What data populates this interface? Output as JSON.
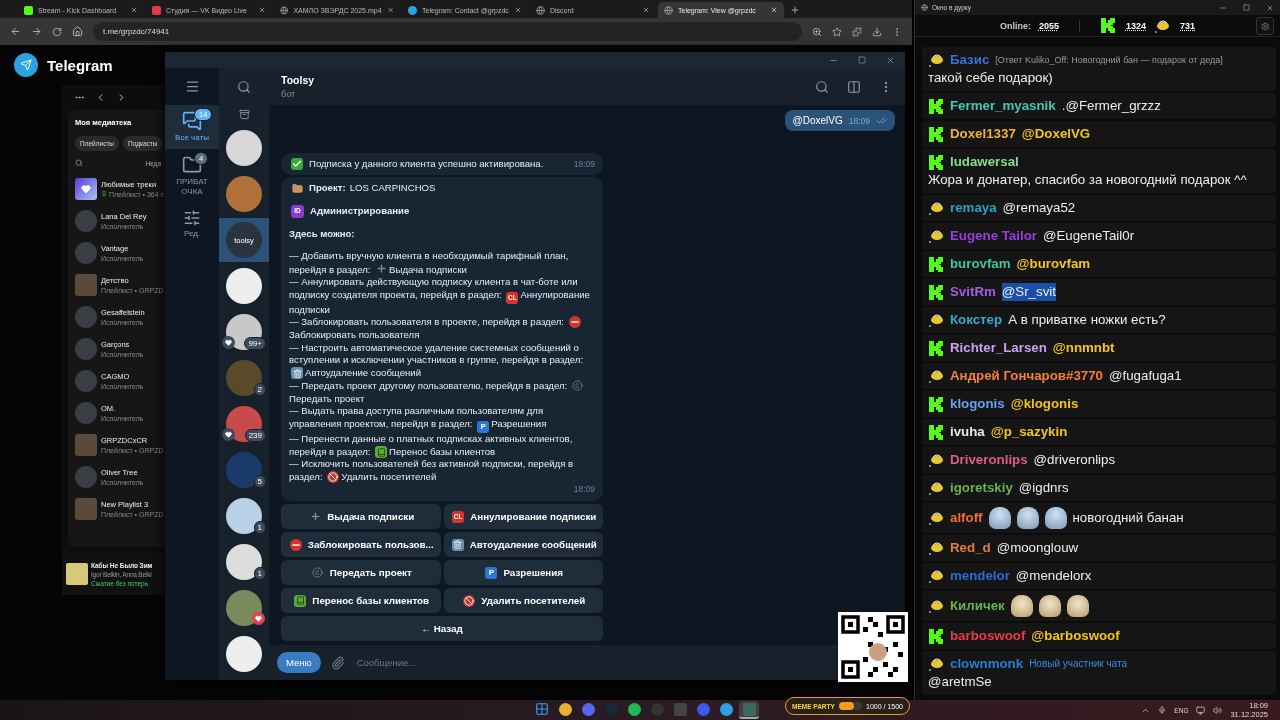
{
  "browser": {
    "tabs": [
      {
        "title": "Stream - Kick Dashboard",
        "selected": false
      },
      {
        "title": "Студия — VK Видео Live",
        "selected": false
      },
      {
        "title": "ХАМЛО ЗВЭРДС 2025.mp4",
        "selected": false
      },
      {
        "title": "Telegram: Contact @grpzdc",
        "selected": false
      },
      {
        "title": "Discord",
        "selected": false
      },
      {
        "title": "Telegram: View @grpzdc",
        "selected": true
      }
    ],
    "address": "t.me/grpzdc/74941"
  },
  "web_header": {
    "title": "Telegram"
  },
  "music": {
    "library_title": "Моя медиатека",
    "chips": [
      "Плейлисты",
      "Подкасты"
    ],
    "sort_label": "Неда",
    "items": [
      {
        "kind": "liked",
        "title": "Любимые треки",
        "subtitle": "Плейлист • 364 т",
        "pinned": true
      },
      {
        "kind": "artist",
        "title": "Lana Del Rey",
        "subtitle": "Исполнитель",
        "pinned": false
      },
      {
        "kind": "artist",
        "title": "Vantage",
        "subtitle": "Исполнитель",
        "pinned": false
      },
      {
        "kind": "playlist",
        "title": "Детство",
        "subtitle": "Плейлист • GRPZD",
        "pinned": false
      },
      {
        "kind": "artist",
        "title": "Gesaffelstein",
        "subtitle": "Исполнитель",
        "pinned": false
      },
      {
        "kind": "artist",
        "title": "Garçons",
        "subtitle": "Исполнитель",
        "pinned": false
      },
      {
        "kind": "artist",
        "title": "CAGMO",
        "subtitle": "Исполнитель",
        "pinned": false
      },
      {
        "kind": "artist",
        "title": "OM.",
        "subtitle": "Исполнитель",
        "pinned": false
      },
      {
        "kind": "playlist",
        "title": "GRPZDCxCR",
        "subtitle": "Плейлист • GRPZD",
        "pinned": false
      },
      {
        "kind": "artist",
        "title": "Oliver Tree",
        "subtitle": "Исполнитель",
        "pinned": false
      },
      {
        "kind": "playlist",
        "title": "New Playlist 3",
        "subtitle": "Плейлист • GRPZD",
        "pinned": false
      }
    ],
    "player": {
      "title": "Кабы Не Было Зим",
      "artist": "Igor Belkin, Anna Belki",
      "quality": "Сжатие без потерь"
    }
  },
  "telegram": {
    "folders": [
      {
        "kind": "chats",
        "label": "Все чаты",
        "badge": "14",
        "selected": true
      },
      {
        "kind": "folder",
        "label": "ПРИВАТ ОЧКА",
        "badge": "4",
        "selected": false
      },
      {
        "kind": "edit",
        "label": "Ред.",
        "selected": false
      }
    ],
    "chats": [
      {
        "selected": false,
        "heart": false
      },
      {
        "selected": false,
        "heart": false
      },
      {
        "selected": true,
        "heart": false,
        "avatar_text": "toolsy"
      },
      {
        "selected": false,
        "heart": false
      },
      {
        "selected": false,
        "heart": true,
        "badge": "99+"
      },
      {
        "selected": false,
        "heart": false,
        "badge": "2"
      },
      {
        "selected": false,
        "heart": true,
        "badge": "239"
      },
      {
        "selected": false,
        "heart": false,
        "badge": "5"
      },
      {
        "selected": false,
        "heart": false,
        "badge": "1"
      },
      {
        "selected": false,
        "heart": false,
        "badge": "1"
      },
      {
        "selected": false,
        "heart": true,
        "heart_red": true
      },
      {
        "selected": false,
        "heart": false
      }
    ],
    "chat": {
      "title": "Toolsy",
      "subtitle": "бот"
    },
    "outgoing": {
      "text": "@DoxelVG",
      "time": "18:09",
      "read": true
    },
    "notice": {
      "icon": {
        "kind": "check"
      },
      "text": "Подписка у данного клиента успешно активирована.",
      "time": "18:09"
    },
    "bot_message": {
      "project_label": "Проект:",
      "project_name": "LOS CARPINCHOS",
      "section_icon": {
        "kind": "id",
        "label": "ID"
      },
      "section_title": "Администрирование",
      "intro": "Здесь можно:",
      "time": "18:09",
      "items": [
        {
          "text": "— Добавить вручную клиента в необходимый тарифный план, перейдя в раздел:",
          "icon": {
            "kind": "plus"
          },
          "target": "Выдача подписки"
        },
        {
          "text": "— Аннулировать действующую подписку клиента в чат-боте или подписку создателя проекта, перейдя в раздел:",
          "icon": {
            "kind": "cl",
            "label": "CL"
          },
          "target": "Аннулирование подписки"
        },
        {
          "text": "— Заблокировать пользователя в проекте, перейдя в раздел:",
          "icon": {
            "kind": "no_entry"
          },
          "target": "Заблокировать пользователя"
        },
        {
          "text": "— Настроить автоматическое удаление системных сообщений о вступлении и исключении участников в группе, перейдя в раздел:",
          "icon": {
            "kind": "bin"
          },
          "target": "Автоудаление сообщений"
        },
        {
          "text": "— Передать проект другому пользователю, перейдя в раздел:",
          "icon": {
            "kind": "copyright"
          },
          "target": "Передать проект"
        },
        {
          "text": "— Выдать права доступа различным пользователям для управления проектом, перейдя в раздел:",
          "icon": {
            "kind": "p",
            "label": "P"
          },
          "target": "Разрешения"
        },
        {
          "text": "— Перенести данные о платных подписках активных клиентов, перейдя в раздел:",
          "icon": {
            "kind": "book"
          },
          "target": "Перенос базы клиентов"
        },
        {
          "text": "— Исключить пользователей без активной подписки, перейдя в раздел:",
          "icon": {
            "kind": "prohibited"
          },
          "target": "Удалить посетителей"
        }
      ]
    },
    "buttons": [
      {
        "icon": {
          "kind": "plus"
        },
        "label": "Выдача подписки",
        "wide": false
      },
      {
        "icon": {
          "kind": "cl",
          "label": "CL"
        },
        "label": "Аннулирование подписки",
        "wide": false
      },
      {
        "icon": {
          "kind": "no_entry"
        },
        "label": "Заблокировать пользов...",
        "wide": false
      },
      {
        "icon": {
          "kind": "bin"
        },
        "label": "Автоудаление сообщений",
        "wide": false
      },
      {
        "icon": {
          "kind": "copyright"
        },
        "label": "Передать проект",
        "wide": false
      },
      {
        "icon": {
          "kind": "p",
          "label": "P"
        },
        "label": "Разрешения",
        "wide": false
      },
      {
        "icon": {
          "kind": "book"
        },
        "label": "Перенос базы клиентов",
        "wide": false
      },
      {
        "icon": {
          "kind": "prohibited"
        },
        "label": "Удалить посетителей",
        "wide": false
      },
      {
        "label": "← Назад",
        "wide": true
      }
    ],
    "composer": {
      "menu_label": "Меню",
      "placeholder": "Сообщение..."
    }
  },
  "chat_window": {
    "title": "Окно в дурку",
    "online_label": "Online:",
    "online": "2055",
    "kick_count": "1324",
    "bowl_count": "731",
    "messages": [
      {
        "kind": "bowl",
        "name": "Базис",
        "color": "#3f6fd6",
        "reply": "[Ответ Kuliko_Off: Новогодний бан — подарок от деда]",
        "text": "такой себе подарок)",
        "mention": false,
        "selected": false
      },
      {
        "kind": "kick",
        "name": "Fermer_myasnik",
        "color": "#45c8b4",
        "text": ".@Fermer_grzzz",
        "mention": false,
        "selected": false
      },
      {
        "kind": "kick",
        "name": "Doxel1337",
        "color": "#f0b040",
        "text": "@DoxelVG",
        "mention": true,
        "selected": false
      },
      {
        "kind": "kick",
        "name": "ludawersal",
        "color": "#86e08e",
        "text": "Жора и донатер, спасибо за новогодний подарок ^^",
        "mention": false,
        "selected": false
      },
      {
        "kind": "bowl",
        "name": "remaya",
        "color": "#2f9ec4",
        "text": "@remaya52",
        "mention": false,
        "selected": false
      },
      {
        "kind": "bowl",
        "name": "Eugene Tailor",
        "color": "#9a3ce2",
        "text": "@EugeneTail0r",
        "mention": false,
        "selected": false
      },
      {
        "kind": "kick",
        "name": "burovfam",
        "color": "#40c4a2",
        "text": "@burovfam",
        "mention": true,
        "selected": false
      },
      {
        "kind": "kick",
        "name": "SvitRm",
        "color": "#a65ae8",
        "text": "@Sr_svit",
        "mention": false,
        "selected": true
      },
      {
        "kind": "bowl",
        "name": "Кокстер",
        "color": "#3aa8ca",
        "text": "А в приватке ножки есть?",
        "mention": false,
        "selected": false
      },
      {
        "kind": "kick",
        "name": "Richter_Larsen",
        "color": "#caa2f2",
        "text": "@nnmnbt",
        "mention": true,
        "selected": false
      },
      {
        "kind": "bowl",
        "name": "Андрей Гончаров#3770",
        "color": "#f0803c",
        "text": "@fugafuga1",
        "mention": false,
        "selected": false
      },
      {
        "kind": "kick",
        "name": "klogonis",
        "color": "#6aa2f2",
        "text": "@klogonis",
        "mention": true,
        "selected": false
      },
      {
        "kind": "kick",
        "name": "ivuha",
        "color": "#f2e2f0",
        "text": "@p_sazykin",
        "mention": true,
        "selected": false
      },
      {
        "kind": "bowl",
        "name": "Driveronlips",
        "color": "#e05c8c",
        "text": "@driveronlips",
        "mention": false,
        "selected": false
      },
      {
        "kind": "bowl",
        "name": "igoretskiy",
        "color": "#6ab24e",
        "text": "@igdnrs",
        "mention": false,
        "selected": false
      },
      {
        "kind": "bowl",
        "name": "alfoff",
        "color": "#f06a3a",
        "emotes": [
          {
            "kind": "ghost"
          },
          {
            "kind": "ghost"
          },
          {
            "kind": "ghost"
          }
        ],
        "text": "новогодний банан",
        "mention": false,
        "selected": false
      },
      {
        "kind": "bowl",
        "name": "Red_d",
        "color": "#e07c42",
        "text": "@moonglouw",
        "mention": false,
        "selected": false
      },
      {
        "kind": "bowl",
        "name": "mendelor",
        "color": "#2a6cd2",
        "text": "@mendelorx",
        "mention": false,
        "selected": false
      },
      {
        "kind": "bowl",
        "name": "Киличек",
        "color": "#6ab24e",
        "emotes": [
          {
            "kind": "hamster"
          },
          {
            "kind": "hamster"
          },
          {
            "kind": "hamster"
          }
        ]
      },
      {
        "kind": "kick",
        "name": "barboswoof",
        "color": "#e83c4c",
        "text": "@barboswoof",
        "mention": true,
        "selected": false
      },
      {
        "kind": "bowl",
        "name": "clownmonk",
        "color": "#2a7cda",
        "note": "Новый участник чата",
        "text": "@aretmSe",
        "mention": false,
        "selected": false
      }
    ]
  },
  "widget": {
    "title": "MEME PARTY",
    "progress": "1000 / 1500",
    "level": 0.67
  },
  "taskbar": {
    "apps": [
      {
        "kind": "start",
        "selected": false
      },
      {
        "kind": "chrome",
        "selected": false
      },
      {
        "kind": "discord",
        "selected": false
      },
      {
        "kind": "steam",
        "selected": false
      },
      {
        "kind": "spotify",
        "selected": false
      },
      {
        "kind": "obs",
        "selected": false
      },
      {
        "kind": "player",
        "selected": false
      },
      {
        "kind": "messenger",
        "selected": false
      },
      {
        "kind": "telegram",
        "selected": false
      },
      {
        "kind": "snip",
        "selected": true
      }
    ],
    "lang": "ENG",
    "time": "18:09",
    "date": "31.12.2025"
  }
}
